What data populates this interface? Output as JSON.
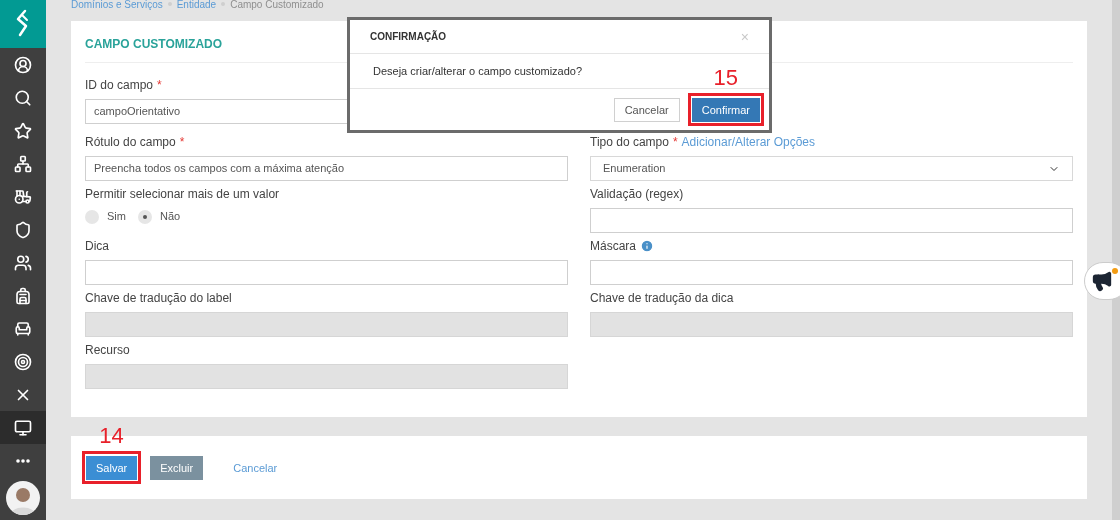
{
  "sidebar": {
    "items": [
      {
        "selected": false
      },
      {
        "selected": false
      },
      {
        "selected": false
      },
      {
        "selected": false
      },
      {
        "selected": false
      },
      {
        "selected": false
      },
      {
        "selected": false
      },
      {
        "selected": false
      },
      {
        "selected": false
      },
      {
        "selected": false
      },
      {
        "selected": false
      },
      {
        "selected": true
      },
      {
        "selected": false
      }
    ]
  },
  "breadcrumb": [
    {
      "label": "Domínios e Serviços",
      "current": false
    },
    {
      "label": "Entidade",
      "current": false
    },
    {
      "label": "Campo Customizado",
      "current": true
    }
  ],
  "form": {
    "title": "CAMPO CUSTOMIZADO",
    "left_fields": [
      {
        "kind": "text",
        "label": "ID do campo",
        "required_mark": "*",
        "value": "campoOrientativo",
        "disabled": false
      },
      {
        "kind": "text",
        "label": "Rótulo do campo",
        "required_mark": "*",
        "value": "Preencha todos os campos com a máxima atenção",
        "disabled": false
      },
      {
        "kind": "radio",
        "label": "Permitir selecionar mais de um valor",
        "options": [
          {
            "label": "Sim",
            "selected": false
          },
          {
            "label": "Não",
            "selected": true
          }
        ]
      },
      {
        "kind": "text",
        "label": "Dica",
        "disabled": false
      },
      {
        "kind": "text",
        "label": "Chave de tradução do label",
        "disabled": true
      },
      {
        "kind": "text",
        "label": "Recurso",
        "disabled": true
      }
    ],
    "right_fields": [
      {
        "kind": "select",
        "label": "Tipo do campo",
        "required_mark": "*",
        "link": "Adicionar/Alterar Opções",
        "value": "Enumeration"
      },
      {
        "kind": "text",
        "label": "Validação (regex)",
        "disabled": false
      },
      {
        "kind": "text",
        "label": "Máscara",
        "info": true,
        "disabled": false
      },
      {
        "kind": "text",
        "label": "Chave de tradução da dica",
        "disabled": true
      }
    ]
  },
  "actions": [
    {
      "kind": "primary",
      "label": "Salvar",
      "highlighted": true,
      "step": "14"
    },
    {
      "kind": "secondary",
      "label": "Excluir",
      "highlighted": false
    },
    {
      "kind": "link",
      "label": "Cancelar",
      "highlighted": false
    }
  ],
  "dialog": {
    "title": "CONFIRMAÇÃO",
    "close": "×",
    "message": "Deseja criar/alterar o campo customizado?",
    "buttons": [
      {
        "kind": "default",
        "label": "Cancelar",
        "highlighted": false
      },
      {
        "kind": "primary",
        "label": "Confirmar",
        "highlighted": true,
        "step": "15"
      }
    ]
  }
}
